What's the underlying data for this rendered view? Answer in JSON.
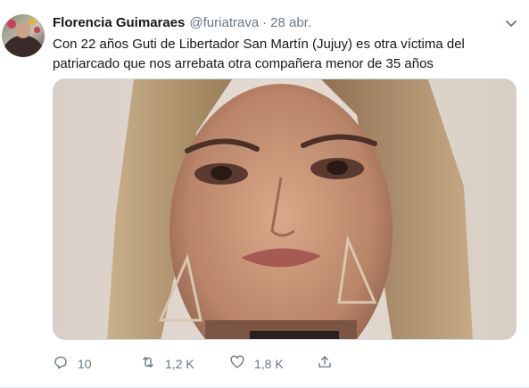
{
  "tweet": {
    "author_name": "Florencia Guimaraes",
    "author_handle": "@furiatrava",
    "separator": "·",
    "date": "28 abr.",
    "text": "Con 22 años Guti de Libertador San Martín (Jujuy) es otra víctima del patriarcado que nos arrebata otra compañera menor de 35 años",
    "actions": {
      "reply_count": "10",
      "retweet_count": "1,2 K",
      "like_count": "1,8 K"
    }
  },
  "icons": {
    "caret": "chevron-down-icon",
    "reply": "reply-icon",
    "retweet": "retweet-icon",
    "like": "heart-icon",
    "share": "share-icon"
  },
  "colors": {
    "text_primary": "#14171a",
    "text_secondary": "#657786",
    "border": "#e6ecf0"
  }
}
